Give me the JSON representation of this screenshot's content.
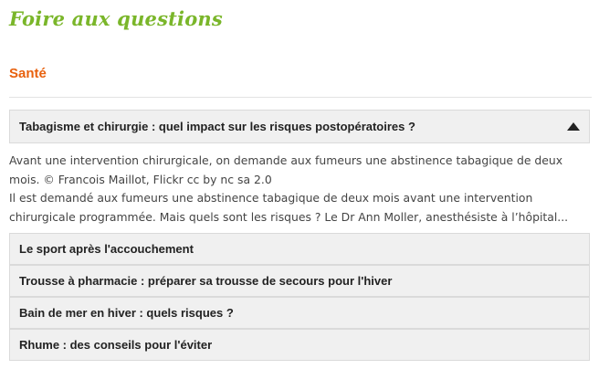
{
  "page": {
    "title": "Foire aux questions"
  },
  "section": {
    "title": "Santé"
  },
  "faq": {
    "open_item": {
      "question": "Tabagisme et chirurgie : quel impact sur les risques postopératoires ?",
      "toggle_icon": "triangle-up-icon",
      "answer_caption": "Avant une intervention chirurgicale, on demande aux fumeurs une abstinence tabagique de deux mois. © Francois Maillot, Flickr cc by nc sa 2.0",
      "answer_excerpt": "Il est demandé aux fumeurs une abstinence tabagique de deux mois avant une intervention chirurgicale programmée. Mais quels sont les risques ? Le Dr Ann Moller, anesthésiste à l’hôpital..."
    },
    "items": [
      {
        "question": "Le sport après l'accouchement"
      },
      {
        "question": "Trousse à pharmacie : préparer sa trousse de secours pour l'hiver"
      },
      {
        "question": "Bain de mer en hiver : quels risques ?"
      },
      {
        "question": "Rhume : des conseils pour l'éviter"
      }
    ]
  },
  "colors": {
    "title_green": "#7ab62a",
    "section_orange": "#e8610e",
    "item_background": "#f0f0f0",
    "item_border": "#dadada"
  }
}
